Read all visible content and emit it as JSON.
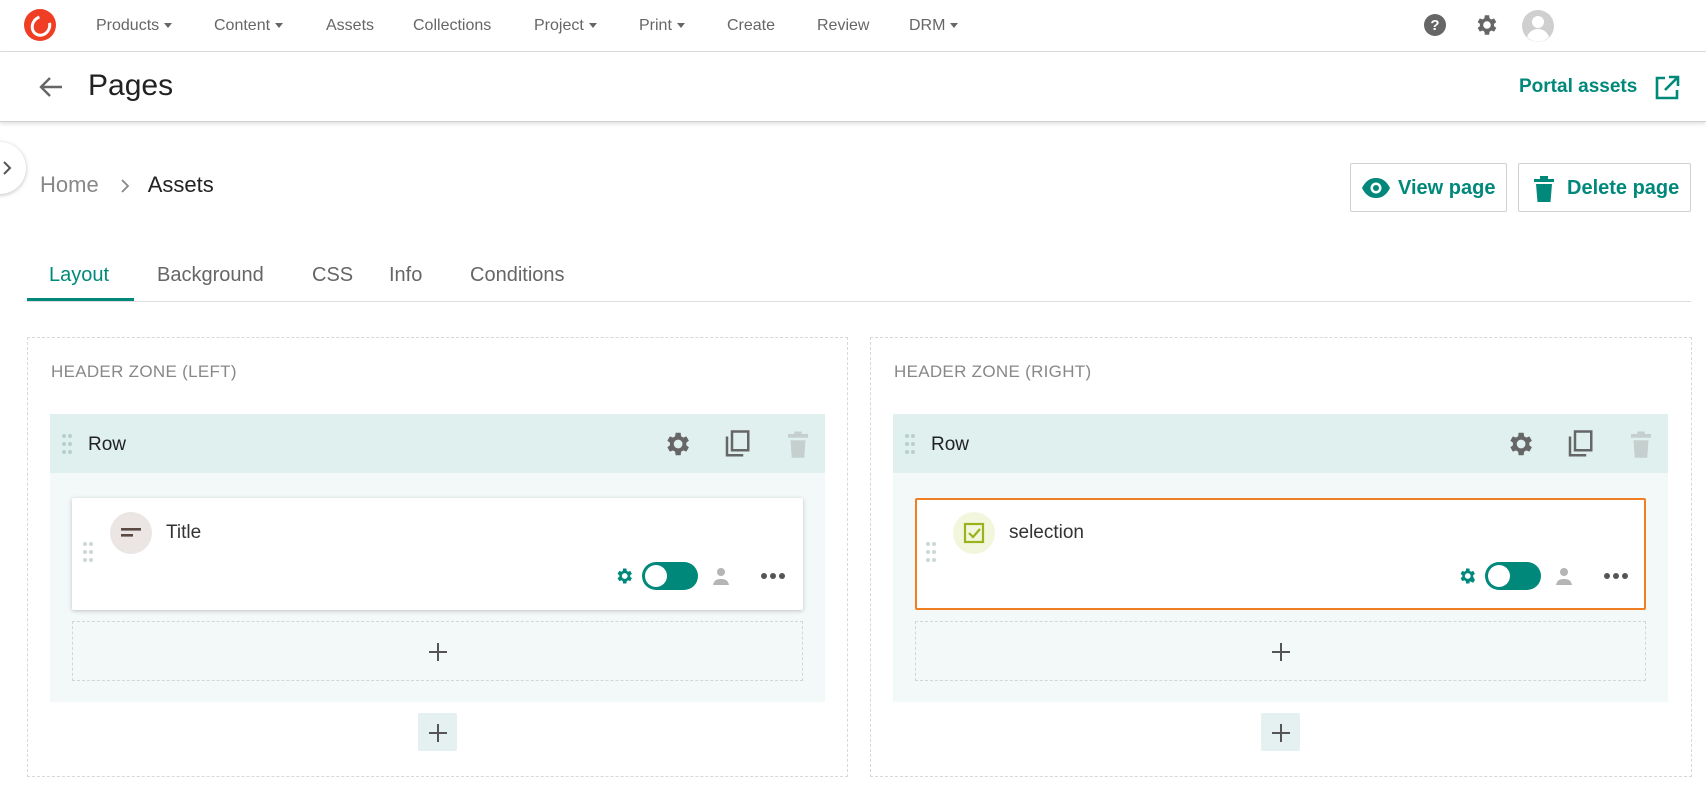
{
  "topnav": {
    "items": [
      {
        "label": "Products",
        "dropdown": true
      },
      {
        "label": "Content",
        "dropdown": true
      },
      {
        "label": "Assets",
        "dropdown": false
      },
      {
        "label": "Collections",
        "dropdown": false
      },
      {
        "label": "Project",
        "dropdown": true
      },
      {
        "label": "Print",
        "dropdown": true
      },
      {
        "label": "Create",
        "dropdown": false
      },
      {
        "label": "Review",
        "dropdown": false
      },
      {
        "label": "DRM",
        "dropdown": true
      }
    ],
    "right_icons": [
      "help-icon",
      "settings-gear-icon",
      "user-avatar-icon"
    ]
  },
  "page": {
    "title": "Pages",
    "portal_link": "Portal assets"
  },
  "breadcrumb": {
    "home": "Home",
    "current": "Assets"
  },
  "actions": {
    "view_page": "View page",
    "delete_page": "Delete page"
  },
  "tabs": {
    "items": [
      "Layout",
      "Background",
      "CSS",
      "Info",
      "Conditions"
    ],
    "active": "Layout"
  },
  "zones": [
    {
      "label": "HEADER ZONE (LEFT)",
      "row_title": "Row",
      "widget": {
        "title": "Title",
        "icon": "text-lines-icon",
        "enabled": true,
        "selected": false
      }
    },
    {
      "label": "HEADER ZONE (RIGHT)",
      "row_title": "Row",
      "widget": {
        "title": "selection",
        "icon": "checkbox-checked-icon",
        "enabled": true,
        "selected": true
      }
    }
  ],
  "colors": {
    "accent": "#00897b",
    "logo": "#ef3e23",
    "selected_outline": "#f07f24",
    "row_header_bg": "#dff0ef",
    "row_body_bg": "#f3f9f8"
  }
}
